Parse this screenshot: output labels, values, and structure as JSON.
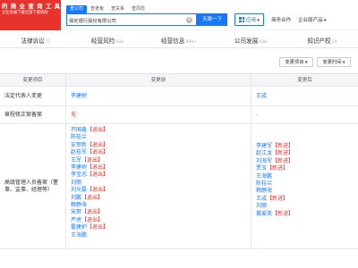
{
  "logo": {
    "line1": "的 商 业 查 询 工 具",
    "line2": "企业发展下载全国下载机构"
  },
  "search": {
    "tabs": [
      "查公司",
      "查老板",
      "查关系",
      "查风险"
    ],
    "value": "保定银行股份有限公司",
    "button": "天眼一下"
  },
  "topbar": {
    "app": "应用",
    "coop": "商务合作",
    "pro": "企业版产品"
  },
  "nav": [
    {
      "label": "法律诉讼",
      "count": "71"
    },
    {
      "label": "经营风险",
      "count": "104"
    },
    {
      "label": "经营信息",
      "count": "999+"
    },
    {
      "label": "公司发展",
      "count": "108"
    },
    {
      "label": "知识产权",
      "count": "19"
    }
  ],
  "filters": [
    "变更项目",
    "变更时间"
  ],
  "table": {
    "headers": [
      "变更项目",
      "变更前",
      "变更后"
    ],
    "rows": [
      {
        "item": "法定代表人变更",
        "before": "李建树",
        "after": "王成"
      },
      {
        "item": "章程修正案备案",
        "before": "无",
        "after": "-"
      }
    ],
    "exec": {
      "item": "高级管理人员备案（董事、监事、经理等）",
      "before": [
        {
          "name": "齐国鑫",
          "tag": "【退出】"
        },
        {
          "name": "陈桂兰",
          "tag": ""
        },
        {
          "name": "安贺新",
          "tag": "【退出】"
        },
        {
          "name": "赵桂军",
          "tag": "【退出】"
        },
        {
          "name": "王军",
          "tag": "【退出】"
        },
        {
          "name": "李建树",
          "tag": "【退出】"
        },
        {
          "name": "李宝忠",
          "tag": "【退出】"
        },
        {
          "name": "刘丽",
          "tag": ""
        },
        {
          "name": "刘光磊",
          "tag": "【退出】"
        },
        {
          "name": "刘鹏",
          "tag": "【退出】"
        },
        {
          "name": "赖静海",
          "tag": ""
        },
        {
          "name": "宋贺",
          "tag": "【退出】"
        },
        {
          "name": "芦虎",
          "tag": "【退出】"
        },
        {
          "name": "霍建护",
          "tag": "【退出】"
        },
        {
          "name": "王海鹏",
          "tag": ""
        }
      ],
      "after": [
        {
          "name": "李建军",
          "tag": "【新进】"
        },
        {
          "name": "赵江龙",
          "tag": "【新进】"
        },
        {
          "name": "刘海军",
          "tag": "【新进】"
        },
        {
          "name": "贾玉",
          "tag": "【新进】"
        },
        {
          "name": "王海鹏",
          "tag": ""
        },
        {
          "name": "陈桂兰",
          "tag": ""
        },
        {
          "name": "赖静海",
          "tag": ""
        },
        {
          "name": "王成",
          "tag": "【新进】"
        },
        {
          "name": "刘丽",
          "tag": ""
        },
        {
          "name": "冀爱英",
          "tag": "【新进】"
        }
      ]
    }
  },
  "colors": {
    "brand_red": "#e8322c",
    "link_blue": "#1677ff"
  }
}
